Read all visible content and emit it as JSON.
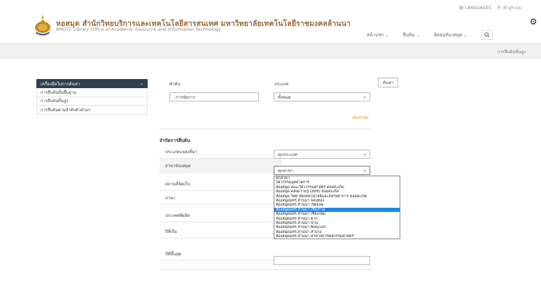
{
  "header": {
    "languages_label": "LANGUAGES",
    "login_label": "เข้าสู่ระบบ",
    "title": "หอสมุด สำนักวิทยบริการและเทคโนโลยีสารสนเทศ มหาวิทยาลัยเทคโนโลยีราชมงคลล้านนา",
    "subtitle": "RMUTL Library Office of Academic Resource and Information Technology",
    "nav": [
      "หน้าแรก",
      "สืบค้น",
      "ติดต่อห้องสมุด"
    ],
    "breadcrumb": "การสืบค้นขั้นสูง"
  },
  "sidebar": {
    "header": "เครื่องมือในการค้นหา",
    "items": [
      "การสืบค้นขั้นพื้นฐาน",
      "การสืบค้นขั้นสูง",
      "การสืบค้นตามลำดับตัวอักษร"
    ]
  },
  "form": {
    "keyword_label": "คำค้น",
    "type_label": "ประเภท",
    "keyword_value": "การจัดการ",
    "type_value": "ทั้งหมด",
    "search_button": "ค้นหา",
    "add_keyword": "เพิ่มคำค้น",
    "limit_section": "จำกัดการสืบค้น",
    "filters": [
      {
        "label": "ประเภทแหล่งที่มา",
        "value": "ทุกประเภท"
      },
      {
        "label": "สาขาห้องสมุด",
        "value": "ทุกสาขา"
      },
      {
        "label": "สถานที่จัดเก็บ",
        "value": ""
      },
      {
        "label": "ภาษา",
        "value": ""
      },
      {
        "label": "ประเทศที่ผลิต",
        "value": ""
      },
      {
        "label": "ปีที่เริ่ม",
        "value": ""
      },
      {
        "label": "ปีที่สิ้นสุด",
        "value": ""
      }
    ]
  },
  "dropdown": {
    "options": [
      "ทุกสาขา",
      "วิศวกรรมอุตสาหการ",
      "ห้องสมุด คณะวิศวกรรมศาสตร์ ดอยสะเก็ด",
      "ห้องสมุด คลังความรู้ (สหช) ดอยสะเก็ด",
      "ห้องสมุด วิทยาลัยเทคโนโลยีและสหวิทยาการ ดอยสะเก็ด",
      "ห้องสมุดมทร.ล้านนา จอมทอง",
      "ห้องสมุดมทร.ล้านนา เจ็ดยอด",
      "ห้องสมุดมทร.ล้านนา เชียงราย",
      "ห้องสมุดมทร.ล้านนา เชียงใหม่",
      "ห้องสมุดมทร.ล้านนา ตาก",
      "ห้องสมุดมทร.ล้านนา น่าน",
      "ห้องสมุดมทร.ล้านนา พิษณุโลก",
      "ห้องสมุดมทร.ล้านนา ลำปาง",
      "ห้องสมุดมทร.ล้านนา สาขาสถาปัตยกรรมศาสตร์"
    ],
    "selected_index": 7
  },
  "colors": {
    "sidebar_header": "#2f3f4f",
    "title": "#9a6a3a",
    "selected_option": "#1e88e5",
    "link": "#d69a2a"
  }
}
